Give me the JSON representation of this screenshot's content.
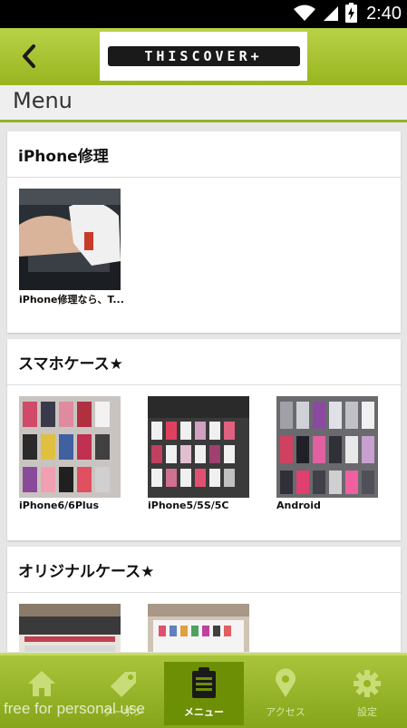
{
  "status_bar": {
    "time": "2:40"
  },
  "header": {
    "logo_text": "THISCOVER+"
  },
  "page": {
    "title": "Menu"
  },
  "sections": [
    {
      "title": "iPhone修理",
      "items": [
        {
          "label": "iPhone修理なら、T..."
        }
      ]
    },
    {
      "title": "スマホケース★",
      "items": [
        {
          "label": "iPhone6/6Plus"
        },
        {
          "label": "iPhone5/5S/5C"
        },
        {
          "label": "Android"
        }
      ]
    },
    {
      "title": "オリジナルケース★",
      "items": [
        {
          "label": ""
        },
        {
          "label": ""
        }
      ]
    }
  ],
  "bottom_nav": [
    {
      "label": "",
      "icon": "home-icon"
    },
    {
      "label": "クーポン",
      "icon": "tag-icon"
    },
    {
      "label": "メニュー",
      "icon": "clipboard-icon"
    },
    {
      "label": "アクセス",
      "icon": "map-pin-icon"
    },
    {
      "label": "設定",
      "icon": "gear-icon"
    }
  ],
  "watermark": "free for personal use",
  "colors": {
    "accent": "#9ab624",
    "active_nav": "#6d8f06",
    "status_bar": "#000000"
  }
}
